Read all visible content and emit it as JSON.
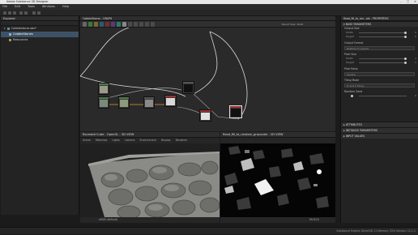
{
  "window": {
    "title": "Adobe Substance 3D Designer"
  },
  "menu": [
    "File",
    "Edit",
    "Tools",
    "Windows",
    "Help"
  ],
  "explorer": {
    "title": "Explorer",
    "tree": [
      {
        "label": "Cobblestone.sbs*",
        "selected": false
      },
      {
        "label": "CobbleStones",
        "selected": true
      },
      {
        "label": "Resources",
        "selected": false
      }
    ]
  },
  "graph": {
    "tab": "CobbleStones - GRAPH",
    "view_size_label": "Parent Size: 2048",
    "node_colors": [
      "#3c7a3c",
      "#7a6a2a",
      "#2a5a7a",
      "#7a2a2a",
      "#5a3a7a",
      "#2a7a6a",
      "#888",
      "#aaa"
    ]
  },
  "view3d": {
    "title": "Rounded Cube - OpenGL - 3D VIEW",
    "menu": [
      "Scene",
      "Materials",
      "Lights",
      "Camera",
      "Environment",
      "Display",
      "Renderer"
    ],
    "footer": "sRGB (default)"
  },
  "view2d": {
    "title": "flood_fill_to_random_grayscale - 2D VIEW",
    "zoom": "99.61%"
  },
  "properties": {
    "title": "flood_fill_to_ran...ale - PROPERTIES",
    "sections": {
      "base": "BASE PARAMETERS",
      "attributes": "ATTRIBUTES",
      "instance": "INSTANCE PARAMETERS",
      "inputs": "INPUT VALUES"
    },
    "output_size": {
      "label": "Output Size",
      "width_label": "Width",
      "height_label": "Height",
      "width_value": "0",
      "height_value": "0",
      "width_rel": "Relative to parent",
      "mode": "Relative to parent"
    },
    "output_format": {
      "label": "Output Format",
      "value": "Relative to parent"
    },
    "pixel_size": {
      "label": "Pixel Size",
      "width_label": "Width",
      "height_label": "Height",
      "width_value": "1",
      "height_value": "1"
    },
    "pixel_ratio": {
      "label": "Pixel Ratio",
      "value": "Square"
    },
    "tiling_mode": {
      "label": "Tiling Mode",
      "value": "H and V Tiling"
    },
    "random_seed": {
      "label": "Random Seed",
      "value": "0"
    }
  },
  "status": {
    "left": "",
    "right": "Substance Engine: Direct3D 11  Memory: 25%   Version: 12.1.1"
  }
}
